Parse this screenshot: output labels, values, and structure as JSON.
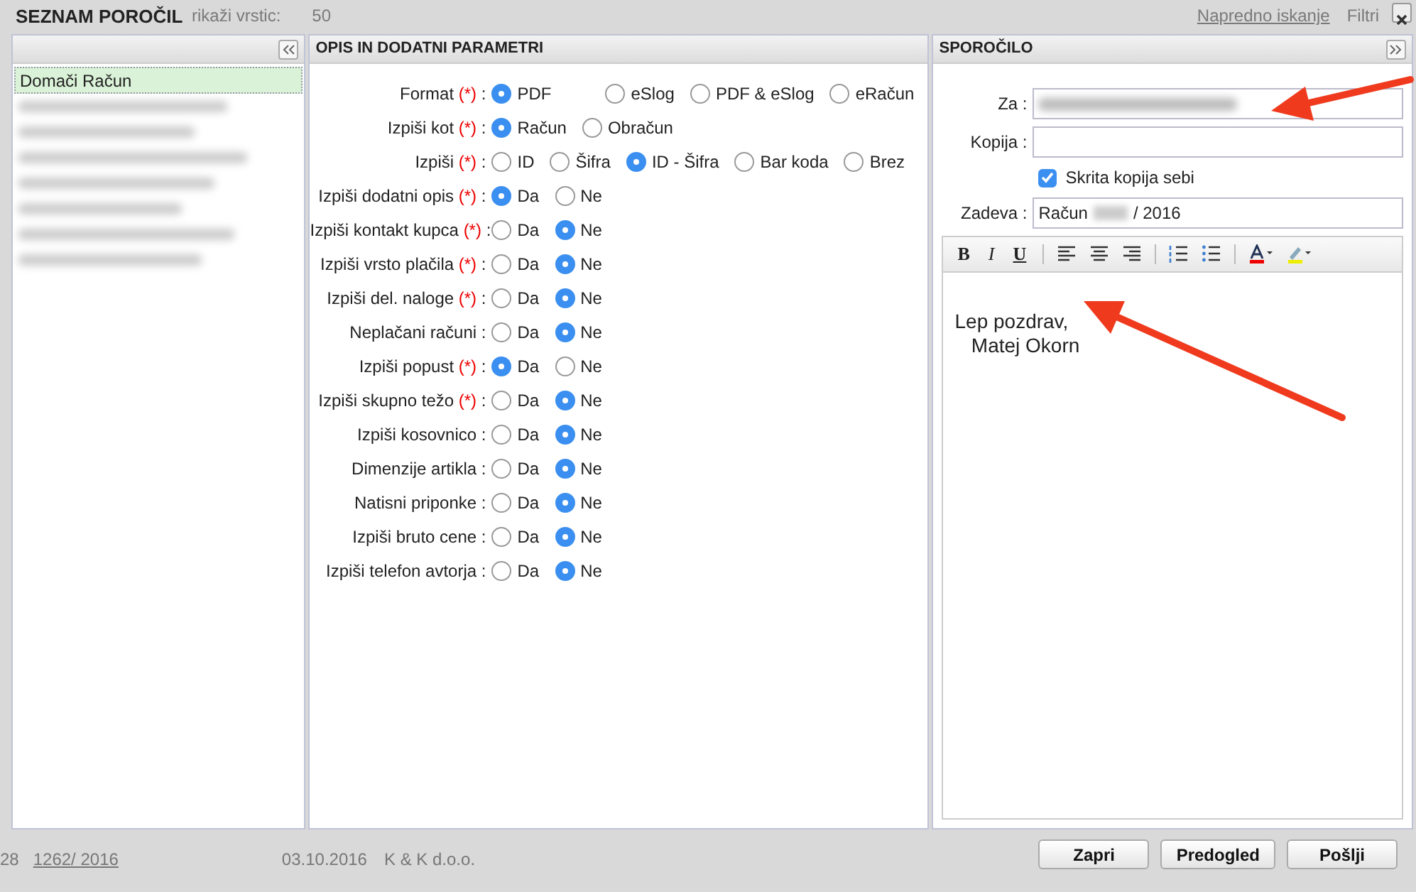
{
  "background": {
    "rows_label": "rikaži vrstic:",
    "rows_value": "50",
    "advanced_search": "Napredno iskanje",
    "filters": "Filtri",
    "row": {
      "number": "28",
      "doc": "1262/ 2016",
      "date": "03.10.2016",
      "customer": "K & K d.o.o."
    }
  },
  "dialog": {
    "title": "SEZNAM POROČIL"
  },
  "reports": {
    "items": [
      {
        "kind": "text",
        "label": "Domači Račun",
        "selected": true
      },
      {
        "kind": "redacted",
        "selected": false
      },
      {
        "kind": "redacted",
        "selected": false
      },
      {
        "kind": "redacted",
        "selected": false
      },
      {
        "kind": "redacted",
        "selected": false
      },
      {
        "kind": "redacted",
        "selected": false
      },
      {
        "kind": "redacted",
        "selected": false
      },
      {
        "kind": "redacted",
        "selected": false
      }
    ]
  },
  "params": {
    "title": "OPIS IN DODATNI PARAMETRI",
    "rows": [
      {
        "label": "Format",
        "required": "(*)",
        "colon": ":",
        "options": [
          {
            "label": "PDF",
            "selected": true
          },
          {
            "label": "eSlog",
            "selected": false
          },
          {
            "label": "PDF & eSlog",
            "selected": false
          },
          {
            "label": "eRačun",
            "selected": false
          }
        ]
      },
      {
        "label": "Izpiši kot",
        "required": "(*)",
        "colon": ":",
        "options": [
          {
            "label": "Račun",
            "selected": true
          },
          {
            "label": "Obračun",
            "selected": false
          }
        ]
      },
      {
        "label": "Izpiši",
        "required": "(*)",
        "colon": ":",
        "options": [
          {
            "label": "ID",
            "selected": false
          },
          {
            "label": "Šifra",
            "selected": false
          },
          {
            "label": "ID - Šifra",
            "selected": true
          },
          {
            "label": "Bar koda",
            "selected": false
          },
          {
            "label": "Brez",
            "selected": false
          }
        ]
      },
      {
        "label": "Izpiši dodatni opis",
        "required": "(*)",
        "colon": ":",
        "options": [
          {
            "label": "Da",
            "selected": true
          },
          {
            "label": "Ne",
            "selected": false
          }
        ]
      },
      {
        "label": "Izpiši kontakt kupca",
        "required": "(*)",
        "colon": ":",
        "options": [
          {
            "label": "Da",
            "selected": false
          },
          {
            "label": "Ne",
            "selected": true
          }
        ]
      },
      {
        "label": "Izpiši vrsto plačila",
        "required": "(*)",
        "colon": ":",
        "options": [
          {
            "label": "Da",
            "selected": false
          },
          {
            "label": "Ne",
            "selected": true
          }
        ]
      },
      {
        "label": "Izpiši del. naloge",
        "required": "(*)",
        "colon": ":",
        "options": [
          {
            "label": "Da",
            "selected": false
          },
          {
            "label": "Ne",
            "selected": true
          }
        ]
      },
      {
        "label": "Neplačani računi",
        "colon": ":",
        "options": [
          {
            "label": "Da",
            "selected": false
          },
          {
            "label": "Ne",
            "selected": true
          }
        ]
      },
      {
        "label": "Izpiši popust",
        "required": "(*)",
        "colon": ":",
        "options": [
          {
            "label": "Da",
            "selected": true
          },
          {
            "label": "Ne",
            "selected": false
          }
        ]
      },
      {
        "label": "Izpiši skupno težo",
        "required": "(*)",
        "colon": ":",
        "options": [
          {
            "label": "Da",
            "selected": false
          },
          {
            "label": "Ne",
            "selected": true
          }
        ]
      },
      {
        "label": "Izpiši kosovnico",
        "colon": ":",
        "options": [
          {
            "label": "Da",
            "selected": false
          },
          {
            "label": "Ne",
            "selected": true
          }
        ]
      },
      {
        "label": "Dimenzije artikla",
        "colon": ":",
        "options": [
          {
            "label": "Da",
            "selected": false
          },
          {
            "label": "Ne",
            "selected": true
          }
        ]
      },
      {
        "label": "Natisni priponke",
        "colon": ":",
        "options": [
          {
            "label": "Da",
            "selected": false
          },
          {
            "label": "Ne",
            "selected": true
          }
        ]
      },
      {
        "label": "Izpiši bruto cene",
        "colon": ":",
        "options": [
          {
            "label": "Da",
            "selected": false
          },
          {
            "label": "Ne",
            "selected": true
          }
        ]
      },
      {
        "label": "Izpiši telefon avtorja",
        "colon": ":",
        "options": [
          {
            "label": "Da",
            "selected": false
          },
          {
            "label": "Ne",
            "selected": true
          }
        ]
      }
    ]
  },
  "message": {
    "title": "SPOROČILO",
    "to": {
      "label": "Za :"
    },
    "cc": {
      "label": "Kopija :"
    },
    "bcc_self": {
      "label": "Skrita kopija sebi",
      "checked": true
    },
    "subject": {
      "label": "Zadeva :",
      "prefix": "Račun",
      "suffix": "/ 2016"
    },
    "toolbar": [
      {
        "kind": "bold",
        "label": "B"
      },
      {
        "kind": "italic",
        "label": "I"
      },
      {
        "kind": "underline",
        "label": "U"
      },
      {
        "kind": "sep"
      },
      {
        "kind": "left"
      },
      {
        "kind": "center"
      },
      {
        "kind": "right"
      },
      {
        "kind": "sep"
      },
      {
        "kind": "ol"
      },
      {
        "kind": "ul"
      },
      {
        "kind": "sep"
      },
      {
        "kind": "color"
      },
      {
        "kind": "highlight"
      }
    ],
    "body": "Lep pozdrav,\n   Matej Okorn"
  },
  "buttons": [
    "Zapri",
    "Predogled",
    "Pošlji"
  ]
}
